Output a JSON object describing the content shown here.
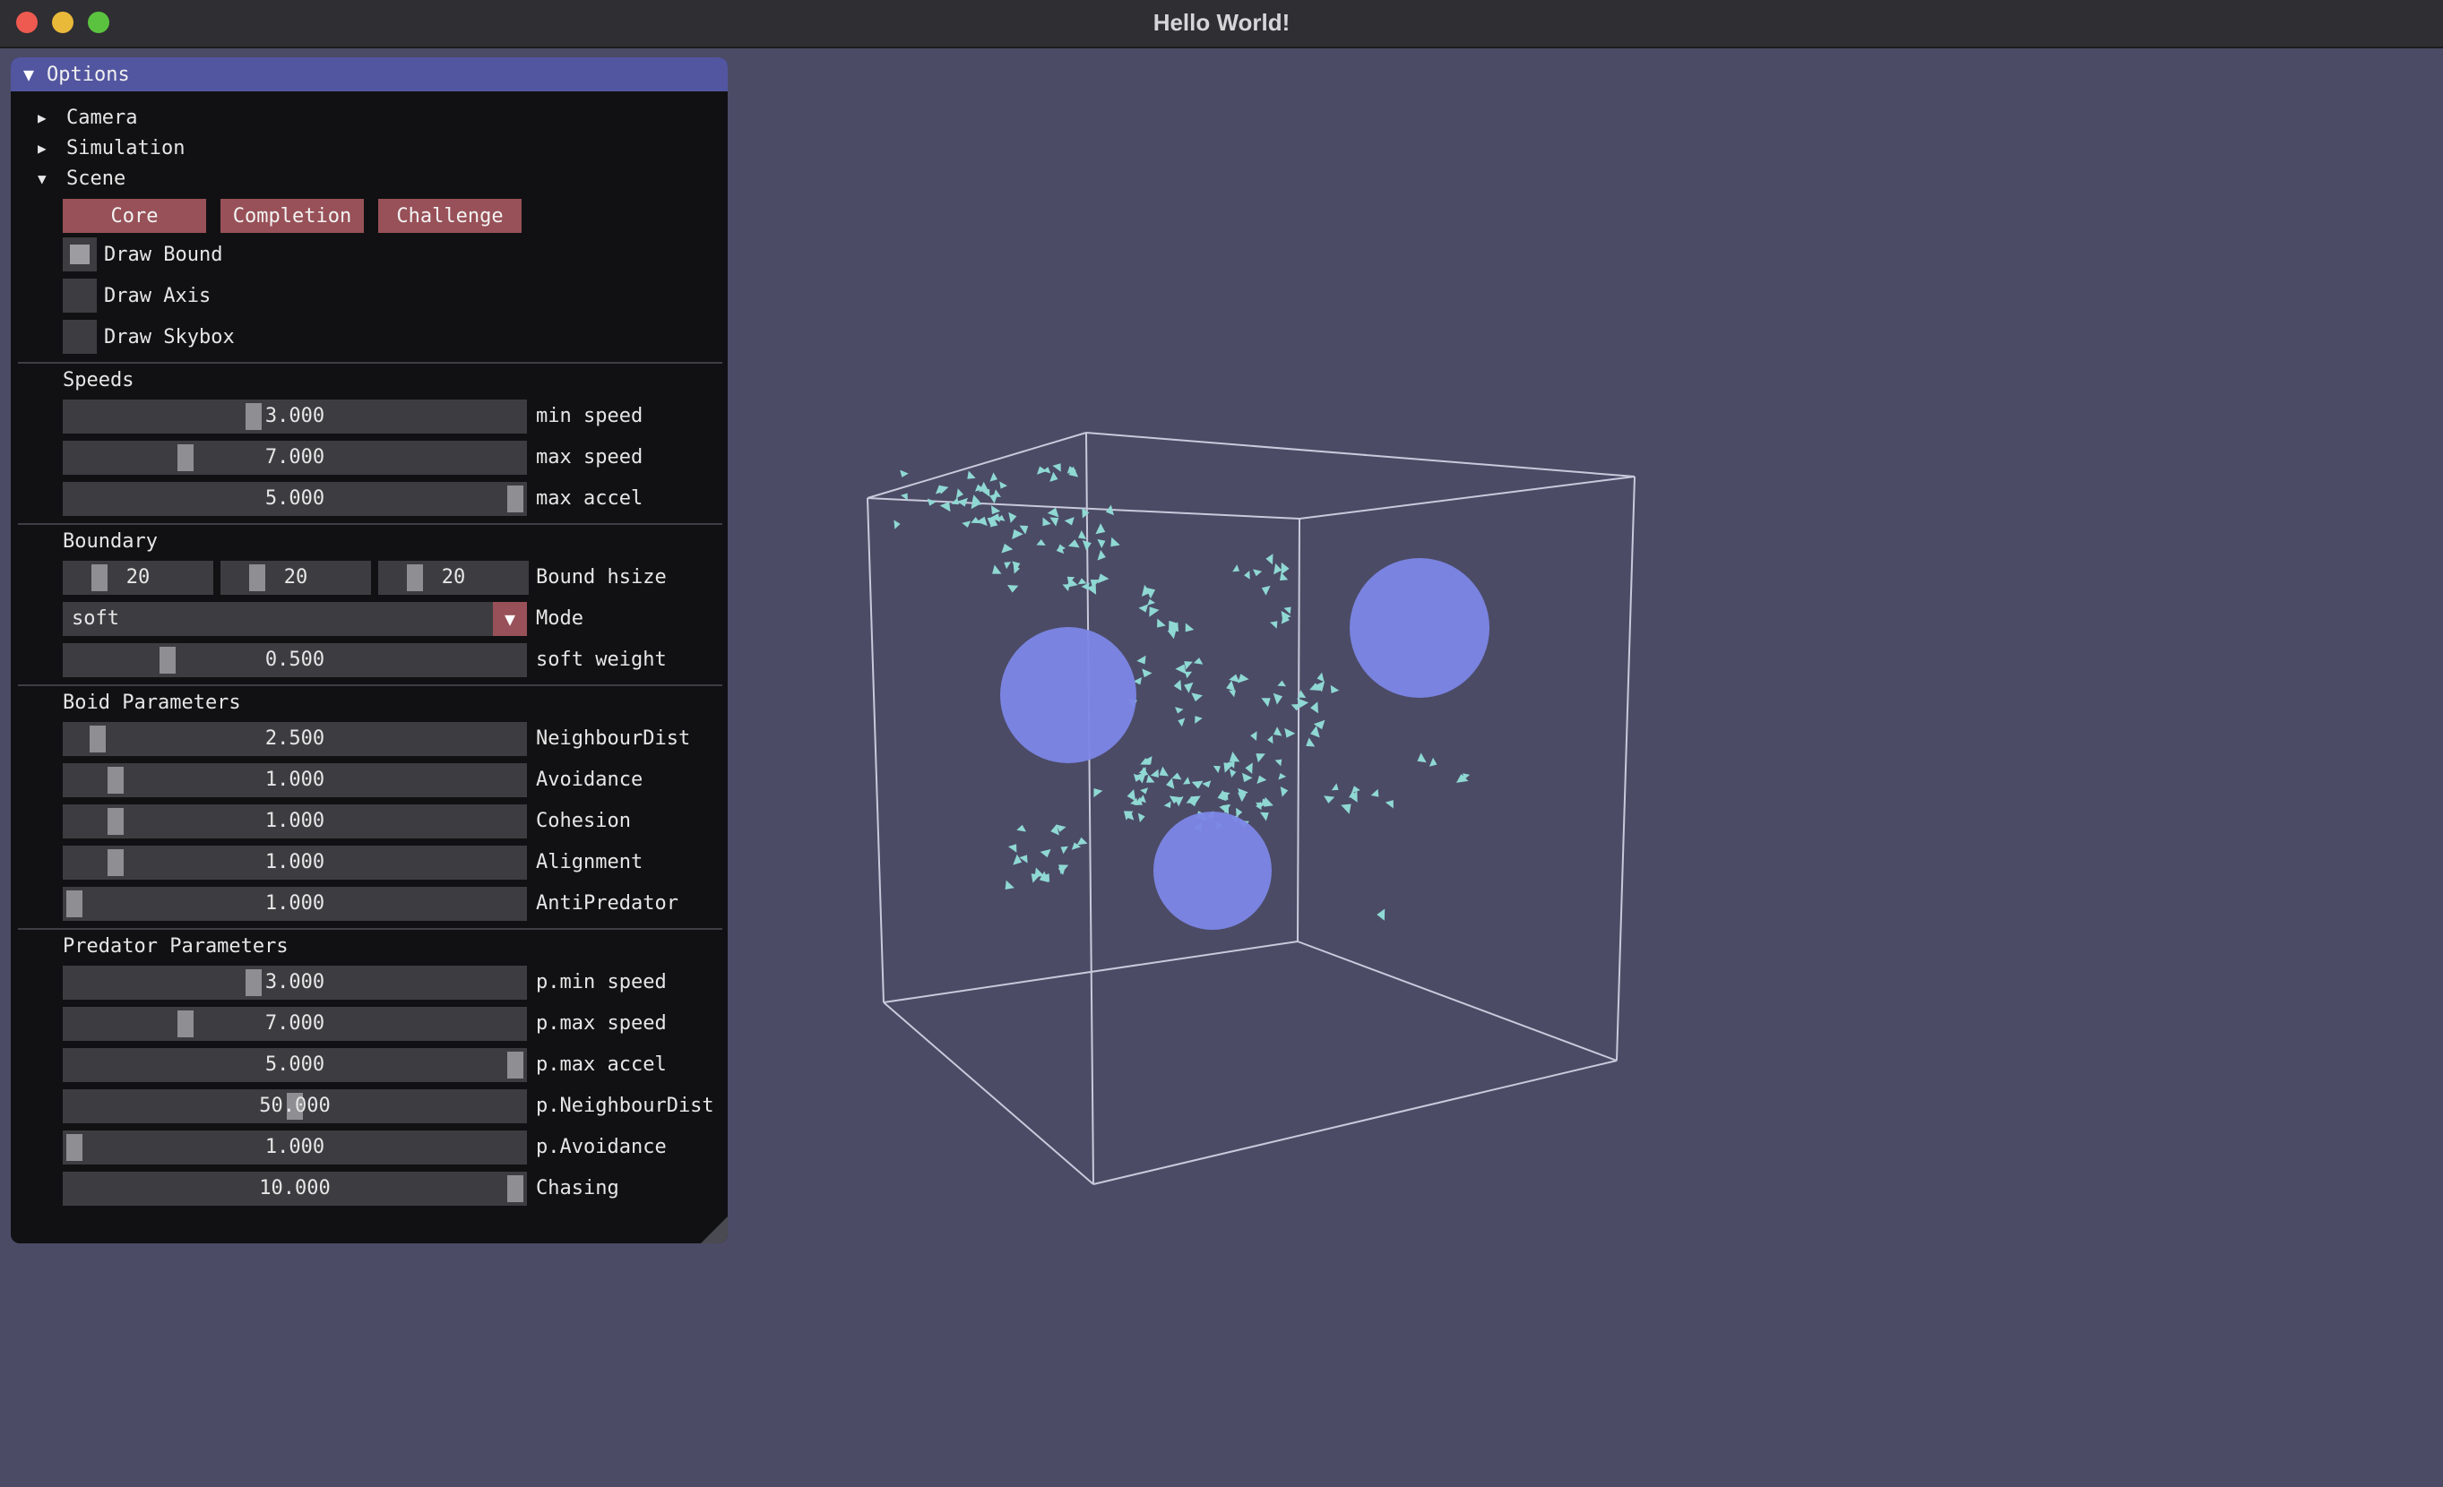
{
  "window": {
    "title": "Hello World!"
  },
  "panel": {
    "title": "Options",
    "tree": {
      "camera": "Camera",
      "simulation": "Simulation",
      "scene": "Scene"
    },
    "scene_buttons": {
      "core": "Core",
      "completion": "Completion",
      "challenge": "Challenge"
    },
    "checkboxes": {
      "draw_bound": {
        "label": "Draw Bound",
        "checked": true
      },
      "draw_axis": {
        "label": "Draw Axis",
        "checked": false
      },
      "draw_skybox": {
        "label": "Draw Skybox",
        "checked": false
      }
    },
    "speeds": {
      "title": "Speeds",
      "min_speed": {
        "value": "3.000",
        "label": "min speed"
      },
      "max_speed": {
        "value": "7.000",
        "label": "max speed"
      },
      "max_accel": {
        "value": "5.000",
        "label": "max accel"
      }
    },
    "boundary": {
      "title": "Boundary",
      "hsize_x": "20",
      "hsize_y": "20",
      "hsize_z": "20",
      "hsize_label": "Bound hsize",
      "mode_value": "soft",
      "mode_label": "Mode",
      "soft_weight": {
        "value": "0.500",
        "label": "soft weight"
      }
    },
    "boid": {
      "title": "Boid Parameters",
      "neighbour_dist": {
        "value": "2.500",
        "label": "NeighbourDist"
      },
      "avoidance": {
        "value": "1.000",
        "label": "Avoidance"
      },
      "cohesion": {
        "value": "1.000",
        "label": "Cohesion"
      },
      "alignment": {
        "value": "1.000",
        "label": "Alignment"
      },
      "anti_predator": {
        "value": "1.000",
        "label": "AntiPredator"
      }
    },
    "predator": {
      "title": "Predator Parameters",
      "min_speed": {
        "value": "3.000",
        "label": "p.min speed"
      },
      "max_speed": {
        "value": "7.000",
        "label": "p.max speed"
      },
      "max_accel": {
        "value": "5.000",
        "label": "p.max accel"
      },
      "neighbour_dist": {
        "value": "50.000",
        "label": "p.NeighbourDist"
      },
      "avoidance": {
        "value": "1.000",
        "label": "p.Avoidance"
      },
      "chasing": {
        "value": "10.000",
        "label": "Chasing"
      }
    }
  },
  "colors": {
    "viewport_background": "#4b4b66",
    "panel_header": "#5256a0",
    "button_accent": "#985158",
    "boid": "#8fd8d3",
    "sphere": "#7c86e6"
  }
}
